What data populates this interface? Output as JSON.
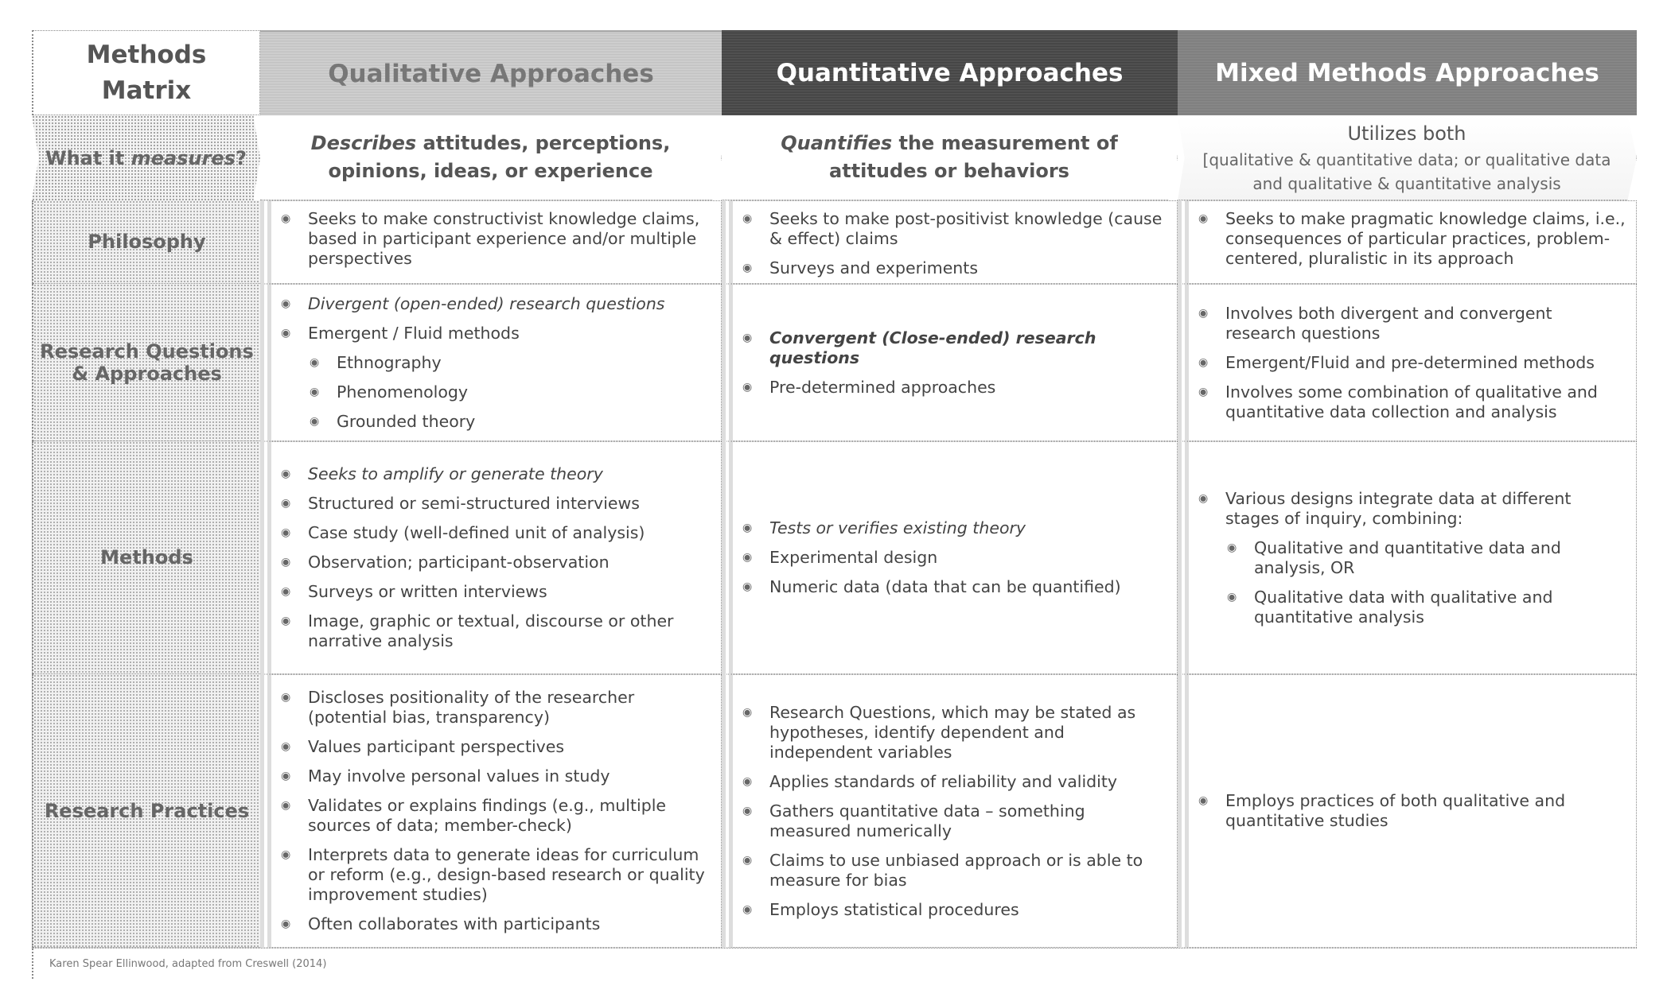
{
  "title": "Methods\nMatrix",
  "columns": [
    {
      "label": "Qualitative Approaches"
    },
    {
      "label": "Quantitative Approaches"
    },
    {
      "label": "Mixed Methods Approaches"
    }
  ],
  "measures": {
    "label_prefix": "What it ",
    "label_em": "measures",
    "label_suffix": "?",
    "qualitative": {
      "em": "Describes",
      "text": " attitudes, perceptions, opinions, ideas, or experience"
    },
    "quantitative": {
      "em": "Quantifies",
      "text": " the measurement of attitudes or behaviors"
    },
    "mixed": {
      "title": "Utilizes both",
      "text": "[qualitative & quantitative data; or qualitative data and qualitative &  quantitative analysis"
    }
  },
  "rows": [
    {
      "label": "Philosophy",
      "qualitative": [
        {
          "text": "Seeks to make constructivist knowledge claims, based in participant experience and/or multiple perspectives"
        }
      ],
      "quantitative": [
        {
          "text": "Seeks to make post-positivist knowledge (cause & effect) claims"
        },
        {
          "text": "Surveys and experiments"
        }
      ],
      "mixed": [
        {
          "text": "Seeks to make pragmatic knowledge claims, i.e., consequences of particular practices, problem-centered, pluralistic in its approach"
        }
      ]
    },
    {
      "label": "Research Questions & Approaches",
      "qualitative": [
        {
          "text": "Divergent (open-ended) research questions",
          "style": "italic"
        },
        {
          "text": "Emergent / Fluid methods",
          "sub": [
            "Ethnography",
            "Phenomenology",
            "Grounded theory"
          ]
        }
      ],
      "quantitative": [
        {
          "text": "Convergent (Close-ended) research questions",
          "style": "italic-bold"
        },
        {
          "text": "Pre-determined approaches"
        }
      ],
      "mixed": [
        {
          "text": "Involves both divergent and convergent research questions"
        },
        {
          "text": "Emergent/Fluid and pre-determined methods"
        },
        {
          "text": "Involves some combination of qualitative and quantitative data collection and analysis"
        }
      ]
    },
    {
      "label": "Methods",
      "qualitative": [
        {
          "text": "Seeks to amplify or generate theory",
          "style": "italic"
        },
        {
          "text": "Structured or semi-structured interviews"
        },
        {
          "text": "Case study (well-defined unit of analysis)"
        },
        {
          "text": "Observation; participant-observation"
        },
        {
          "text": "Surveys or written interviews"
        },
        {
          "text": "Image, graphic or textual, discourse or other narrative analysis"
        }
      ],
      "quantitative": [
        {
          "text": "Tests or verifies existing theory",
          "style": "italic"
        },
        {
          "text": "Experimental design"
        },
        {
          "text": "Numeric data (data that can be quantified)"
        }
      ],
      "mixed": [
        {
          "text": "Various designs integrate data at different stages of inquiry, combining:",
          "sub": [
            "Qualitative and quantitative data and analysis, OR",
            "Qualitative data with qualitative and quantitative analysis"
          ]
        }
      ]
    },
    {
      "label": "Research Practices",
      "qualitative": [
        {
          "text": "Discloses positionality of the researcher (potential bias, transparency)"
        },
        {
          "text": "Values participant perspectives"
        },
        {
          "text": "May involve personal values in study"
        },
        {
          "text": "Validates or explains findings (e.g., multiple sources of data; member-check)"
        },
        {
          "text": "Interprets data to generate ideas for curriculum or reform (e.g., design-based research or quality improvement studies)"
        },
        {
          "text": "Often collaborates with participants"
        }
      ],
      "quantitative": [
        {
          "text": "Research Questions, which may be stated as hypotheses, identify dependent and independent variables"
        },
        {
          "text": "Applies standards of reliability and validity"
        },
        {
          "text": "Gathers quantitative data – something measured numerically"
        },
        {
          "text": "Claims to use unbiased approach or is able to measure for bias"
        },
        {
          "text": "Employs statistical procedures"
        }
      ],
      "mixed": [
        {
          "text": "Employs practices of both qualitative and quantitative studies"
        }
      ]
    }
  ],
  "credit": "Karen Spear Ellinwood, adapted from Creswell (2014)",
  "icons": {
    "bullet": "bullet-icon"
  }
}
